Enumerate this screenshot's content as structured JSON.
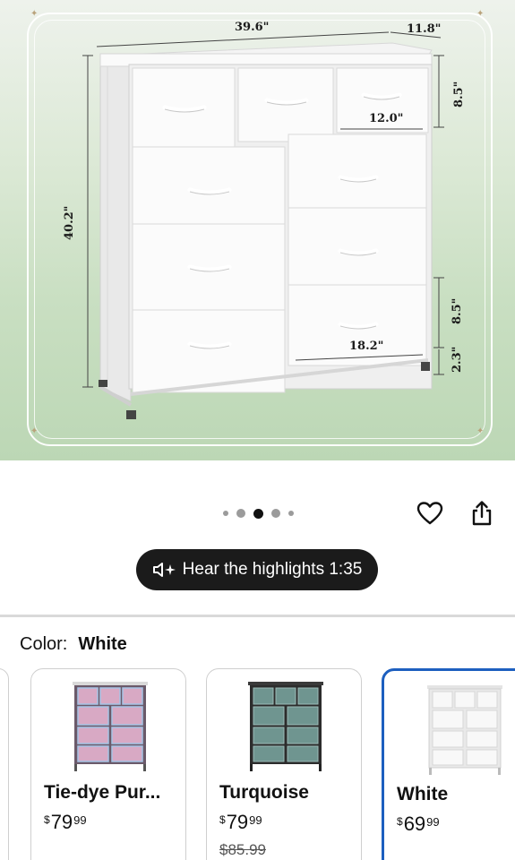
{
  "product_image": {
    "dimensions": {
      "width": "39.6\"",
      "depth": "11.8\"",
      "height": "40.2\"",
      "top_drawer_height": "8.5\"",
      "small_drawer_width": "12.0\"",
      "large_drawer_width": "18.2\"",
      "drawer_height": "8.5\"",
      "leg_height": "2.3\""
    }
  },
  "carousel": {
    "dot_count": 5,
    "active_index": 2
  },
  "actions": {
    "favorite_icon": "heart-icon",
    "share_icon": "share-icon"
  },
  "highlights": {
    "label": "Hear the highlights 1:35",
    "icon": "speaker-sparkle-icon"
  },
  "color": {
    "label": "Color:",
    "selected": "White"
  },
  "swatches": [
    {
      "name": "Tie-dye Pur...",
      "currency": "$",
      "price_whole": "79",
      "price_cents": "99",
      "was_price": "",
      "body_color": "#d8a9c4",
      "frame_color": "#6b5a6a",
      "pattern": "#a7c4e6"
    },
    {
      "name": "Turquoise",
      "currency": "$",
      "price_whole": "79",
      "price_cents": "99",
      "was_price": "$85.99",
      "body_color": "#6f9590",
      "frame_color": "#2c2c2c",
      "pattern": "#9dbcb8"
    },
    {
      "name": "White",
      "currency": "$",
      "price_whole": "69",
      "price_cents": "99",
      "was_price": "",
      "body_color": "#f6f6f6",
      "frame_color": "#d0d0d0",
      "pattern": "#ffffff",
      "selected": true
    }
  ],
  "accent_color": "#1d5fbf"
}
